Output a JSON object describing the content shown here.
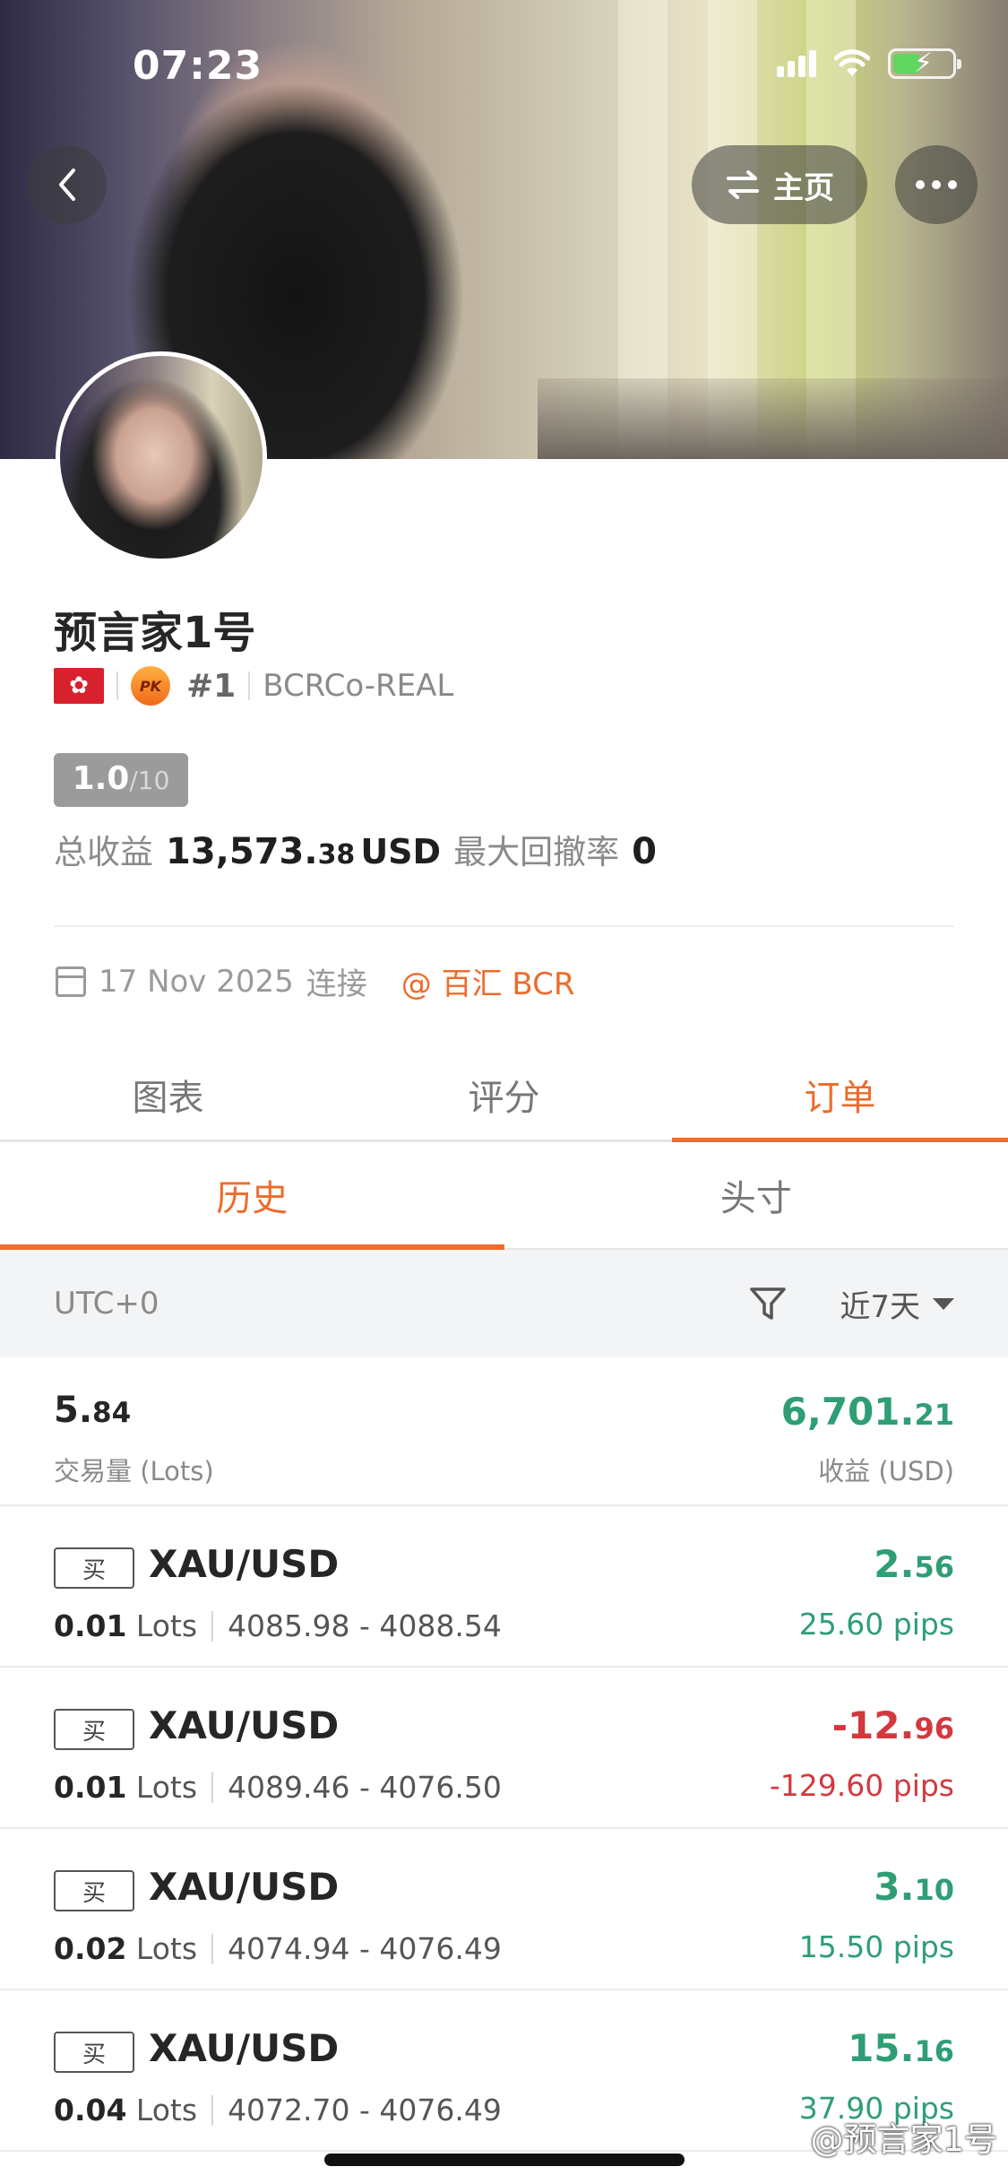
{
  "status_bar": {
    "time": "07:23"
  },
  "header": {
    "back_icon": "chevron-left-icon",
    "home_button_label": "主页",
    "home_button_icon": "switch-arrows-icon",
    "more_icon": "ellipsis-icon"
  },
  "profile": {
    "name": "预言家1号",
    "flag_icon": "hong-kong-flag-icon",
    "badge_icon_text": "PK",
    "rank": "#1",
    "account": "BCRCo-REAL",
    "score_value": "1.0",
    "score_max": "/10",
    "total_profit_label": "总收益",
    "total_profit_int": "13,573.",
    "total_profit_dec": "38",
    "total_profit_unit": "USD",
    "max_drawdown_label": "最大回撤率",
    "max_drawdown_value": "0",
    "connect_date": "17 Nov 2025",
    "connect_label": "连接",
    "broker_link": "@ 百汇 BCR"
  },
  "tabs": [
    {
      "label": "图表"
    },
    {
      "label": "评分"
    },
    {
      "label": "订单"
    }
  ],
  "active_tab": "订单",
  "subtabs": [
    {
      "label": "历史"
    },
    {
      "label": "头寸"
    }
  ],
  "active_subtab": "历史",
  "filter": {
    "timezone": "UTC+0",
    "range_label": "近7天"
  },
  "summary": {
    "lots_int": "5.",
    "lots_dec": "84",
    "lots_label": "交易量 (Lots)",
    "profit_int": "6,701.",
    "profit_dec": "21",
    "profit_label": "收益 (USD)"
  },
  "orders": [
    {
      "side": "买",
      "symbol": "XAU/USD",
      "lots": "0.01",
      "lots_unit": "Lots",
      "range": "4085.98 - 4088.54",
      "pnl_int": "2.",
      "pnl_dec": "56",
      "pips": "25.60 pips",
      "positive": true
    },
    {
      "side": "买",
      "symbol": "XAU/USD",
      "lots": "0.01",
      "lots_unit": "Lots",
      "range": "4089.46 - 4076.50",
      "pnl_int": "-12.",
      "pnl_dec": "96",
      "pips": "-129.60 pips",
      "positive": false
    },
    {
      "side": "买",
      "symbol": "XAU/USD",
      "lots": "0.02",
      "lots_unit": "Lots",
      "range": "4074.94 - 4076.49",
      "pnl_int": "3.",
      "pnl_dec": "10",
      "pips": "15.50 pips",
      "positive": true
    },
    {
      "side": "买",
      "symbol": "XAU/USD",
      "lots": "0.04",
      "lots_unit": "Lots",
      "range": "4072.70 - 4076.49",
      "pnl_int": "15.",
      "pnl_dec": "16",
      "pips": "37.90 pips",
      "positive": true
    }
  ],
  "colors": {
    "accent": "#ec6c2c",
    "profit_green": "#2f9e74",
    "loss_red": "#d2393f"
  },
  "watermark": "@预言家1号"
}
